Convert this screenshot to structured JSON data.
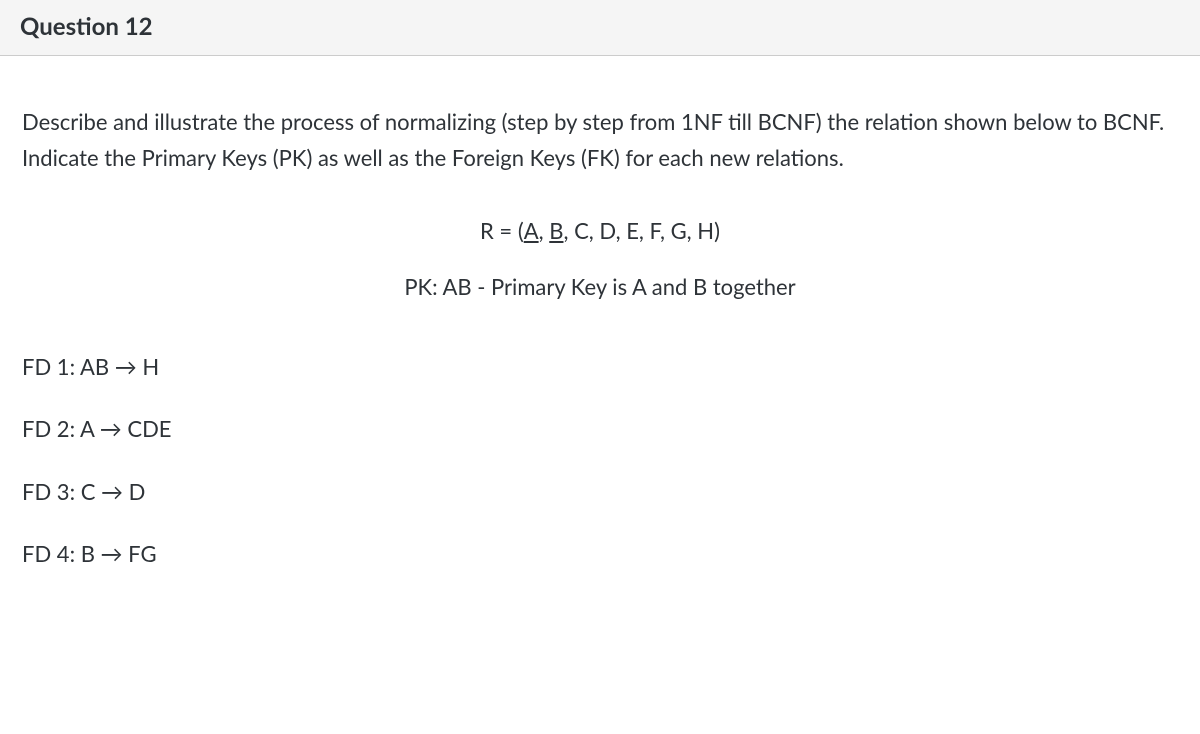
{
  "header": {
    "title": "Question 12"
  },
  "body": {
    "instruction": "Describe and illustrate the process of normalizing (step by step from 1NF till BCNF) the relation shown below to BCNF. Indicate the Primary Keys (PK) as well as the Foreign Keys (FK) for each new relations.",
    "relation_prefix": "R = (",
    "relation_key_A": "A",
    "relation_sep1": ", ",
    "relation_key_B": "B",
    "relation_suffix": ", C, D, E, F, G, H)",
    "pk_line": "PK: AB - Primary Key is A and B together",
    "fds": [
      "FD 1: AB → H",
      "FD 2: A → CDE",
      "FD 3: C → D",
      "FD 4: B → FG"
    ]
  }
}
